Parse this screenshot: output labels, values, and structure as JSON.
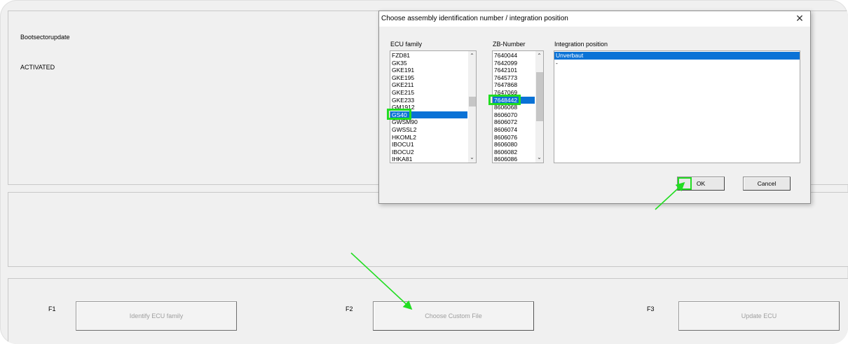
{
  "main": {
    "status_label": "Bootsectorupdate",
    "status_value": "ACTIVATED",
    "fkeys": [
      {
        "key": "F1",
        "label": "Identify ECU family"
      },
      {
        "key": "F2",
        "label": "Choose Custom File"
      },
      {
        "key": "F3",
        "label": "Update ECU"
      }
    ]
  },
  "dialog": {
    "title": "Choose assembly identification number / integration position",
    "close_glyph": "✕",
    "ecu_family": {
      "label": "ECU family",
      "items": [
        "FZD81",
        "GK35",
        "GKE191",
        "GKE195",
        "GKE211",
        "GKE215",
        "GKE233",
        "GM1912",
        "GS40",
        "GWSM90",
        "GWSSL2",
        "HKOML2",
        "IBOCU1",
        "IBOCU2",
        "IHKA81"
      ],
      "selected": "GS40"
    },
    "zb_number": {
      "label": "ZB-Number",
      "items": [
        "7640044",
        "7642099",
        "7642101",
        "7645773",
        "7647868",
        "7647069",
        "7648442",
        "8606068",
        "8606070",
        "8606072",
        "8606074",
        "8606076",
        "8606080",
        "8606082",
        "8606086"
      ],
      "selected": "7648442"
    },
    "integration": {
      "label": "Integration position",
      "items": [
        "Unverbaut",
        "-"
      ],
      "selected": "Unverbaut"
    },
    "ok_label": "OK",
    "cancel_label": "Cancel"
  },
  "colors": {
    "selection": "#0a72d6",
    "annotation": "#22dd22"
  }
}
